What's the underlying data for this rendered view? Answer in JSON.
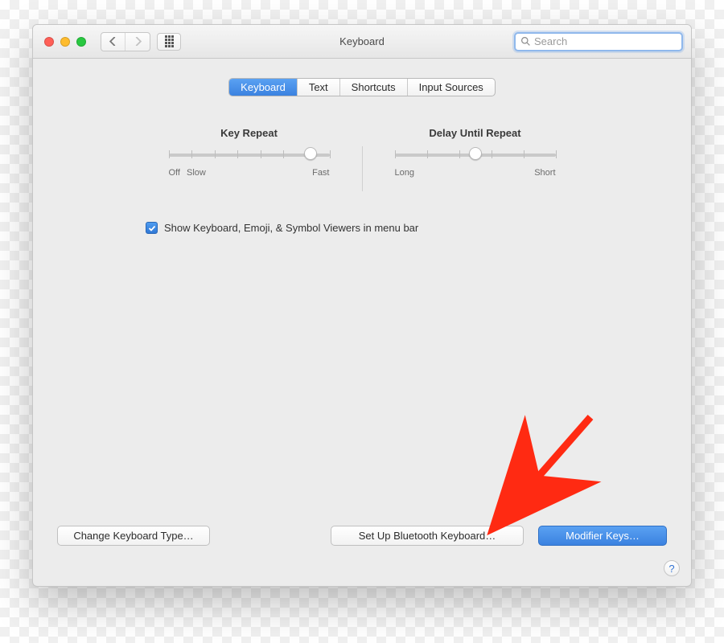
{
  "window": {
    "title": "Keyboard",
    "search_placeholder": "Search"
  },
  "tabs": [
    {
      "label": "Keyboard",
      "active": true
    },
    {
      "label": "Text",
      "active": false
    },
    {
      "label": "Shortcuts",
      "active": false
    },
    {
      "label": "Input Sources",
      "active": false
    }
  ],
  "sliders": {
    "key_repeat": {
      "title": "Key Repeat",
      "left_label_1": "Off",
      "left_label_2": "Slow",
      "right_label": "Fast",
      "position_pct": 88,
      "ticks": 8
    },
    "delay_until_repeat": {
      "title": "Delay Until Repeat",
      "left_label": "Long",
      "right_label": "Short",
      "position_pct": 50,
      "ticks": 6
    }
  },
  "checkbox": {
    "checked": true,
    "label": "Show Keyboard, Emoji, & Symbol Viewers in menu bar"
  },
  "buttons": {
    "change_keyboard_type": "Change Keyboard Type…",
    "bluetooth_keyboard": "Set Up Bluetooth Keyboard…",
    "modifier_keys": "Modifier Keys…"
  },
  "help_label": "?"
}
